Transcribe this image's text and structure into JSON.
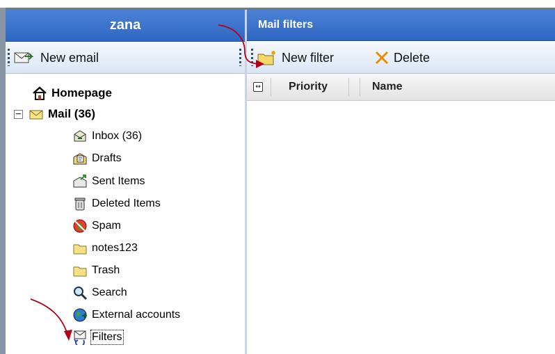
{
  "left_panel": {
    "user_name": "zana",
    "new_email_label": "New email"
  },
  "folder_tree": {
    "homepage": "Homepage",
    "mail": "Mail (36)",
    "inbox": "Inbox (36)",
    "drafts": "Drafts",
    "sent": "Sent Items",
    "deleted": "Deleted Items",
    "spam": "Spam",
    "notes": "notes123",
    "trash": "Trash",
    "search": "Search",
    "external": "External accounts",
    "filters": "Filters",
    "mail_expander": "−"
  },
  "right_panel": {
    "title": "Mail filters",
    "new_filter_label": "New filter",
    "delete_label": "Delete",
    "columns": {
      "priority": "Priority",
      "name": "Name"
    }
  },
  "colors": {
    "header_blue": "#3a72cc",
    "annotation_red": "#b3001b",
    "folder_yellow": "#f6e08a",
    "delete_orange": "#f08a00"
  },
  "icons": {
    "homepage": "house-icon",
    "mail": "envelope-icon",
    "inbox": "inbox-icon",
    "drafts": "drafts-icon",
    "sent": "sent-icon",
    "deleted": "trash-can-icon",
    "spam": "spam-bug-icon",
    "folder": "folder-icon",
    "search": "magnifier-icon",
    "external": "globe-icon",
    "filters": "filter-envelope-icon"
  }
}
